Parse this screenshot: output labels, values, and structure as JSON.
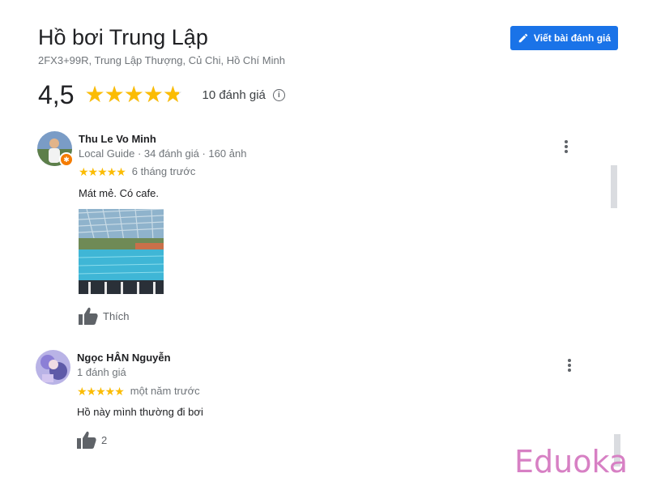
{
  "place": {
    "title": "Hồ bơi Trung Lập",
    "address": "2FX3+99R, Trung Lập Thượng, Củ Chi, Hồ Chí Minh"
  },
  "write_review_label": "Viết bài đánh giá",
  "summary": {
    "rating": "4,5",
    "rating_value": 4.5,
    "max_rating": 5,
    "review_count": "10 đánh giá"
  },
  "reviews": [
    {
      "name": "Thu Le Vo Minh",
      "meta": "Local Guide · 34 đánh giá · 160 ảnh",
      "stars": 5,
      "when": "6 tháng trước",
      "text": "Mát mẻ. Có cafe.",
      "like_label": "Thích"
    },
    {
      "name": "Ngọc HÂN Nguyễn",
      "meta": "1 đánh giá",
      "stars": 5,
      "when": "một năm trước",
      "text": "Hồ này mình thường đi bơi",
      "like_label": "2"
    }
  ],
  "watermark": "Eduoka",
  "colors": {
    "accent": "#1a73e8",
    "star": "#fbbc04",
    "watermark": "#d780c4"
  }
}
